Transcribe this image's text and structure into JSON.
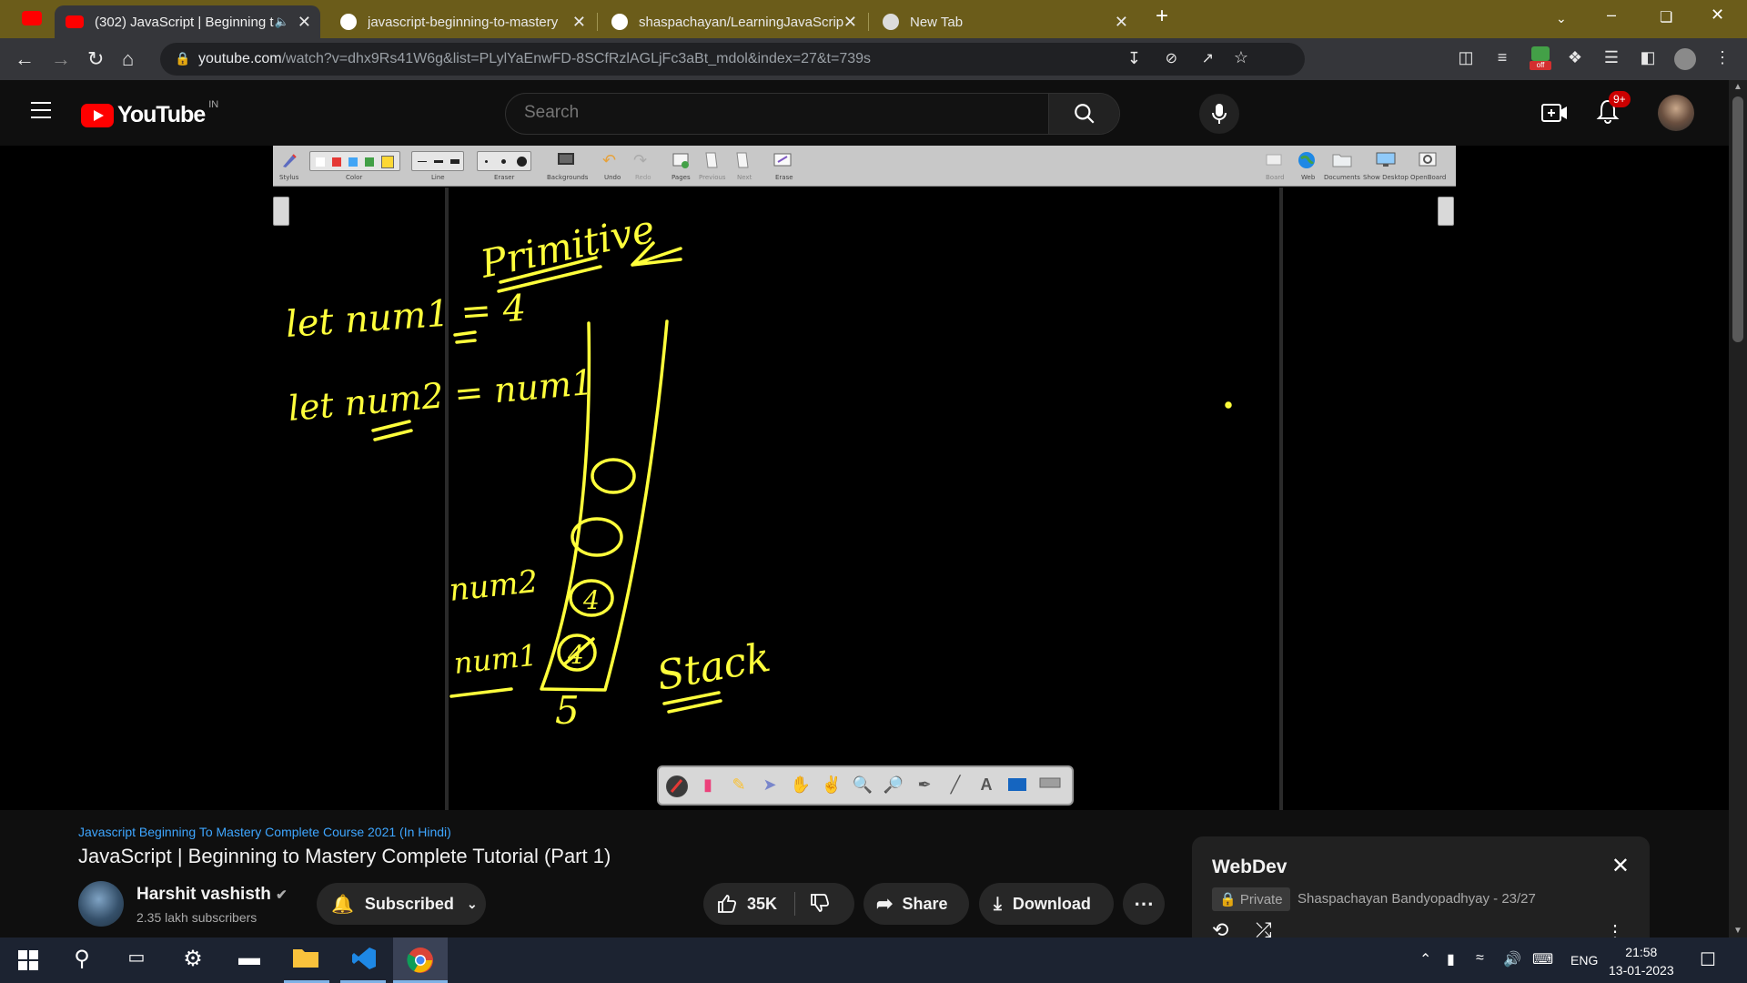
{
  "browser": {
    "tabs": [
      {
        "title": "(302) JavaScript | Beginning t",
        "active": true
      },
      {
        "title": "javascript-beginning-to-mastery",
        "active": false
      },
      {
        "title": "shaspachayan/LearningJavaScrip",
        "active": false
      },
      {
        "title": "New Tab",
        "active": false
      }
    ],
    "url_host": "youtube.com",
    "url_path": "/watch?v=dhx9Rs41W6g&list=PLylYaEnwFD-8SCfRzlAGLjFc3aBt_mdol&index=27&t=739s",
    "extension_badge": "off"
  },
  "youtube": {
    "logo_text": "YouTube",
    "region": "IN",
    "search_placeholder": "Search",
    "notif_count": "9+"
  },
  "whiteboard": {
    "toolbar_labels": [
      "Stylus",
      "Color",
      "Line",
      "Eraser",
      "Backgrounds",
      "Undo",
      "Redo",
      "Pages",
      "Previous",
      "Next",
      "Erase",
      "Board",
      "Web",
      "Documents",
      "Show Desktop",
      "OpenBoard"
    ],
    "colors": [
      "#ffffff",
      "#e53935",
      "#42a5f5",
      "#43a047",
      "#fdd835"
    ],
    "handwriting": {
      "heading": "Primitive",
      "line1": "let num1 = 4",
      "line2": "let num2 = num1",
      "label_num2": "num2",
      "label_num1": "num1",
      "stack_value_num2": "4",
      "stack_value_num1": "4",
      "new_value": "5",
      "stack_label": "Stack"
    },
    "ink_color": "#ffff3b"
  },
  "video": {
    "playlist_link": "Javascript Beginning To Mastery Complete Course 2021 (In Hindi)",
    "title": "JavaScript | Beginning to Mastery Complete Tutorial (Part 1)",
    "channel": "Harshit vashisth",
    "subscribers": "2.35 lakh subscribers",
    "subscribe_label": "Subscribed",
    "likes": "35K",
    "share_label": "Share",
    "download_label": "Download"
  },
  "playlist": {
    "name": "WebDev",
    "privacy": "Private",
    "meta": "Shaspachayan Bandyopadhyay - 23/27"
  },
  "taskbar": {
    "lang": "ENG",
    "time": "21:58",
    "date": "13-01-2023"
  }
}
